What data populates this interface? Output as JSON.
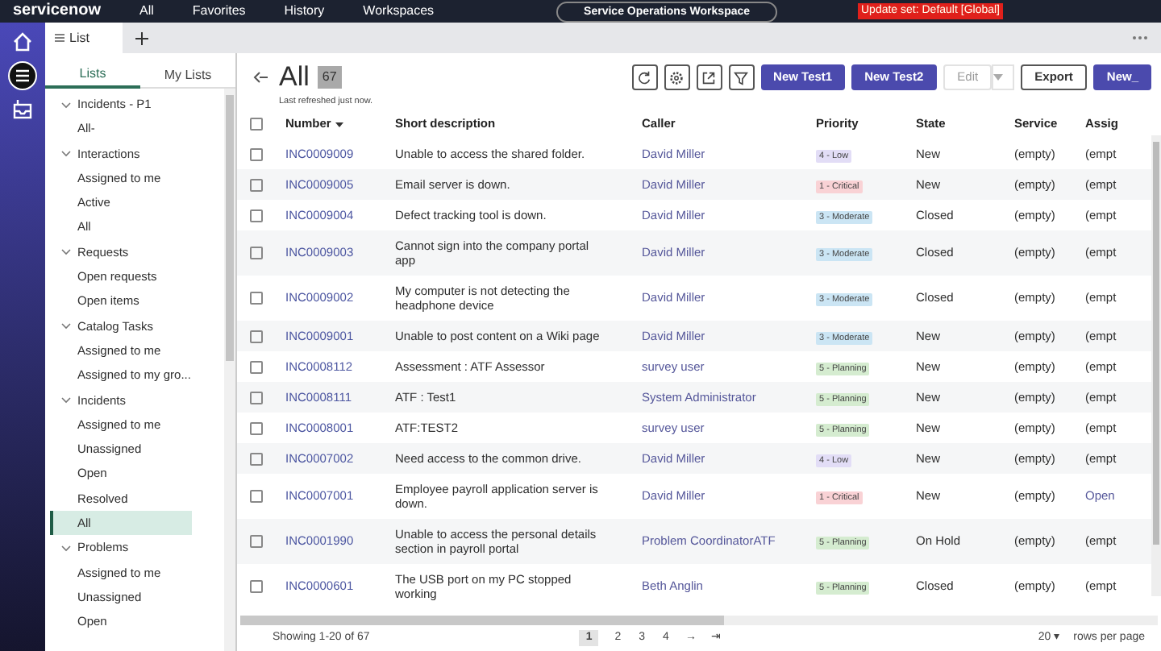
{
  "top_bar": {
    "logo": "servicenow",
    "menu": [
      "All",
      "Favorites",
      "History",
      "Workspaces"
    ],
    "workspace": "Service Operations Workspace",
    "update_set": "Update set: Default [Global]"
  },
  "tabs": [
    {
      "label": "List",
      "selected": true
    }
  ],
  "lists_panel": {
    "tabs": [
      {
        "label": "Lists",
        "selected": true
      },
      {
        "label": "My Lists",
        "selected": false
      }
    ],
    "groups": [
      {
        "label": "Incidents - P1",
        "expanded": true,
        "children": [
          {
            "label": "All-",
            "selected": false
          }
        ]
      },
      {
        "label": "Interactions",
        "expanded": true,
        "children": [
          {
            "label": "Assigned to me",
            "selected": false
          },
          {
            "label": "Active",
            "selected": false
          },
          {
            "label": "All",
            "selected": false
          }
        ]
      },
      {
        "label": "Requests",
        "expanded": true,
        "children": [
          {
            "label": "Open requests",
            "selected": false
          },
          {
            "label": "Open items",
            "selected": false
          }
        ]
      },
      {
        "label": "Catalog Tasks",
        "expanded": true,
        "children": [
          {
            "label": "Assigned to me",
            "selected": false
          },
          {
            "label": "Assigned to my gro...",
            "selected": false
          }
        ]
      },
      {
        "label": "Incidents",
        "expanded": true,
        "children": [
          {
            "label": "Assigned to me",
            "selected": false
          },
          {
            "label": "Unassigned",
            "selected": false
          },
          {
            "label": "Open",
            "selected": false
          },
          {
            "label": "Resolved",
            "selected": false
          },
          {
            "label": "All",
            "selected": true
          }
        ]
      },
      {
        "label": "Problems",
        "expanded": true,
        "children": [
          {
            "label": "Assigned to me",
            "selected": false
          },
          {
            "label": "Unassigned",
            "selected": false
          },
          {
            "label": "Open",
            "selected": false
          }
        ]
      }
    ]
  },
  "list": {
    "title": "All",
    "count": "67",
    "refreshed": "Last refreshed just now.",
    "buttons": [
      {
        "label": "New Test1",
        "kind": "primary",
        "disabled": false
      },
      {
        "label": "New Test2",
        "kind": "primary",
        "disabled": false
      },
      {
        "label": "Edit",
        "kind": "split",
        "disabled": true
      },
      {
        "label": "Export",
        "kind": "outline",
        "disabled": false
      },
      {
        "label": "New_",
        "kind": "primary",
        "disabled": false
      }
    ],
    "select_all_checked": false,
    "columns": [
      "Number",
      "Short description",
      "Caller",
      "Priority",
      "State",
      "Service",
      "Assig"
    ],
    "rows": [
      {
        "checked": false,
        "number": "INC0009009",
        "description": "Unable to access the shared folder.",
        "caller": "David Miller",
        "priority": {
          "label": "4 - Low",
          "color": "#e2ddf6"
        },
        "state": "New",
        "service": "(empty)",
        "column_7": "(empt"
      },
      {
        "checked": false,
        "number": "INC0009005",
        "description": "Email server is down.",
        "caller": "David Miller",
        "priority": {
          "label": "1 - Critical",
          "color": "#f9d2d5"
        },
        "state": "New",
        "service": "(empty)",
        "column_7": "(empt"
      },
      {
        "checked": false,
        "number": "INC0009004",
        "description": "Defect tracking tool is down.",
        "caller": "David Miller",
        "priority": {
          "label": "3 - Moderate",
          "color": "#cbe5f4"
        },
        "state": "Closed",
        "service": "(empty)",
        "column_7": "(empt"
      },
      {
        "checked": false,
        "number": "INC0009003",
        "description": "Cannot sign into the company portal app",
        "caller": "David Miller",
        "priority": {
          "label": "3 - Moderate",
          "color": "#cbe5f4"
        },
        "state": "Closed",
        "service": "(empty)",
        "column_7": "(empt"
      },
      {
        "checked": false,
        "number": "INC0009002",
        "description": "My computer is not detecting the headphone device",
        "caller": "David Miller",
        "priority": {
          "label": "3 - Moderate",
          "color": "#cbe5f4"
        },
        "state": "Closed",
        "service": "(empty)",
        "column_7": "(empt"
      },
      {
        "checked": false,
        "number": "INC0009001",
        "description": "Unable to post content on a Wiki page",
        "caller": "David Miller",
        "priority": {
          "label": "3 - Moderate",
          "color": "#cbe5f4"
        },
        "state": "New",
        "service": "(empty)",
        "column_7": "(empt"
      },
      {
        "checked": false,
        "number": "INC0008112",
        "description": "Assessment : ATF Assessor",
        "caller": "survey user",
        "priority": {
          "label": "5 - Planning",
          "color": "#d5ecd0"
        },
        "state": "New",
        "service": "(empty)",
        "column_7": "(empt"
      },
      {
        "checked": false,
        "number": "INC0008111",
        "description": "ATF : Test1",
        "caller": "System Administrator",
        "priority": {
          "label": "5 - Planning",
          "color": "#d5ecd0"
        },
        "state": "New",
        "service": "(empty)",
        "column_7": "(empt"
      },
      {
        "checked": false,
        "number": "INC0008001",
        "description": "ATF:TEST2",
        "caller": "survey user",
        "priority": {
          "label": "5 - Planning",
          "color": "#d5ecd0"
        },
        "state": "New",
        "service": "(empty)",
        "column_7": "(empt"
      },
      {
        "checked": false,
        "number": "INC0007002",
        "description": "Need access to the common drive.",
        "caller": "David Miller",
        "priority": {
          "label": "4 - Low",
          "color": "#e2ddf6"
        },
        "state": "New",
        "service": "(empty)",
        "column_7": "(empt"
      },
      {
        "checked": false,
        "number": "INC0007001",
        "description": "Employee payroll application server is down.",
        "caller": "David Miller",
        "priority": {
          "label": "1 - Critical",
          "color": "#f9d2d5"
        },
        "state": "New",
        "service": "(empty)",
        "column_7": "Open"
      },
      {
        "checked": false,
        "number": "INC0001990",
        "description": "Unable to access the personal details section in payroll portal",
        "caller": "Problem CoordinatorATF",
        "priority": {
          "label": "5 - Planning",
          "color": "#d5ecd0"
        },
        "state": "On Hold",
        "service": "(empty)",
        "column_7": "(empt"
      },
      {
        "checked": false,
        "number": "INC0000601",
        "description": "The USB port on my PC stopped working",
        "caller": "Beth Anglin",
        "priority": {
          "label": "5 - Planning",
          "color": "#d5ecd0"
        },
        "state": "Closed",
        "service": "(empty)",
        "column_7": "(empt"
      }
    ],
    "footer": {
      "showing": "Showing 1-20 of 67",
      "pages": [
        {
          "label": "1",
          "selected": true
        },
        {
          "label": "2",
          "selected": false
        },
        {
          "label": "3",
          "selected": false
        },
        {
          "label": "4",
          "selected": false
        }
      ],
      "next": "→",
      "last": "⇥",
      "rows_per_page": "20 ▾",
      "rows_label": "rows per page"
    }
  }
}
